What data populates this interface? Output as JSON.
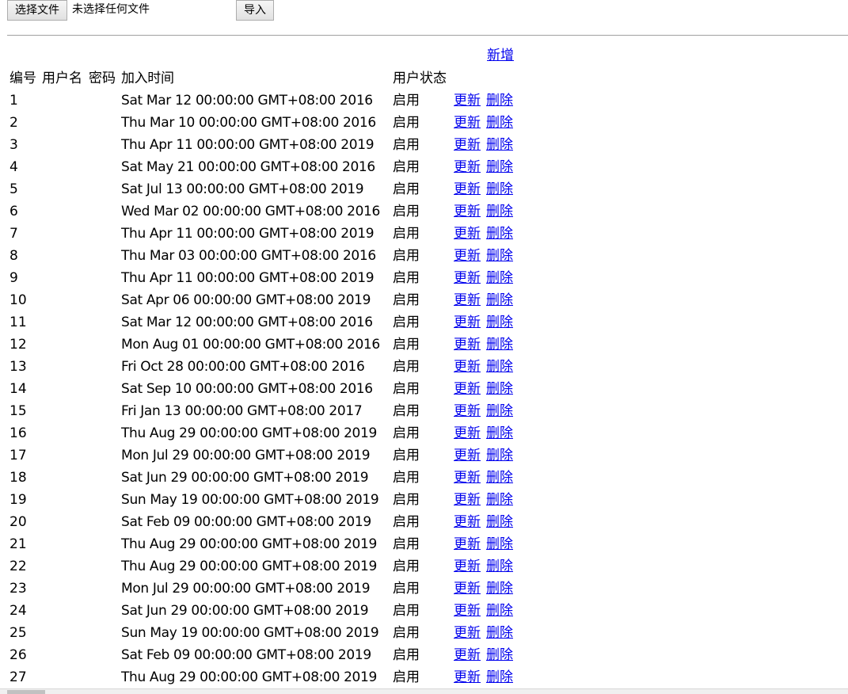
{
  "upload": {
    "choose_label": "选择文件",
    "file_status": "未选择任何文件",
    "import_label": "导入"
  },
  "add_label": "新增",
  "table": {
    "headers": {
      "id": "编号",
      "username": "用户名",
      "password": "密码",
      "join_time": "加入时间",
      "status": "用户状态"
    },
    "update_label": "更新",
    "delete_label": "删除",
    "rows": [
      {
        "id": "1",
        "username": "",
        "password": "",
        "join_time": "Sat Mar 12 00:00:00 GMT+08:00 2016",
        "status": "启用"
      },
      {
        "id": "2",
        "username": "",
        "password": "",
        "join_time": "Thu Mar 10 00:00:00 GMT+08:00 2016",
        "status": "启用"
      },
      {
        "id": "3",
        "username": "",
        "password": "",
        "join_time": "Thu Apr 11 00:00:00 GMT+08:00 2019",
        "status": "启用"
      },
      {
        "id": "4",
        "username": "",
        "password": "",
        "join_time": "Sat May 21 00:00:00 GMT+08:00 2016",
        "status": "启用"
      },
      {
        "id": "5",
        "username": "",
        "password": "",
        "join_time": "Sat Jul 13 00:00:00 GMT+08:00 2019",
        "status": "启用"
      },
      {
        "id": "6",
        "username": "",
        "password": "",
        "join_time": "Wed Mar 02 00:00:00 GMT+08:00 2016",
        "status": "启用"
      },
      {
        "id": "7",
        "username": "",
        "password": "",
        "join_time": "Thu Apr 11 00:00:00 GMT+08:00 2019",
        "status": "启用"
      },
      {
        "id": "8",
        "username": "",
        "password": "",
        "join_time": "Thu Mar 03 00:00:00 GMT+08:00 2016",
        "status": "启用"
      },
      {
        "id": "9",
        "username": "",
        "password": "",
        "join_time": "Thu Apr 11 00:00:00 GMT+08:00 2019",
        "status": "启用"
      },
      {
        "id": "10",
        "username": "",
        "password": "",
        "join_time": "Sat Apr 06 00:00:00 GMT+08:00 2019",
        "status": "启用"
      },
      {
        "id": "11",
        "username": "",
        "password": "",
        "join_time": "Sat Mar 12 00:00:00 GMT+08:00 2016",
        "status": "启用"
      },
      {
        "id": "12",
        "username": "",
        "password": "",
        "join_time": "Mon Aug 01 00:00:00 GMT+08:00 2016",
        "status": "启用"
      },
      {
        "id": "13",
        "username": "",
        "password": "",
        "join_time": "Fri Oct 28 00:00:00 GMT+08:00 2016",
        "status": "启用"
      },
      {
        "id": "14",
        "username": "",
        "password": "",
        "join_time": "Sat Sep 10 00:00:00 GMT+08:00 2016",
        "status": "启用"
      },
      {
        "id": "15",
        "username": "",
        "password": "",
        "join_time": "Fri Jan 13 00:00:00 GMT+08:00 2017",
        "status": "启用"
      },
      {
        "id": "16",
        "username": "",
        "password": "",
        "join_time": "Thu Aug 29 00:00:00 GMT+08:00 2019",
        "status": "启用"
      },
      {
        "id": "17",
        "username": "",
        "password": "",
        "join_time": "Mon Jul 29 00:00:00 GMT+08:00 2019",
        "status": "启用"
      },
      {
        "id": "18",
        "username": "",
        "password": "",
        "join_time": "Sat Jun 29 00:00:00 GMT+08:00 2019",
        "status": "启用"
      },
      {
        "id": "19",
        "username": "",
        "password": "",
        "join_time": "Sun May 19 00:00:00 GMT+08:00 2019",
        "status": "启用"
      },
      {
        "id": "20",
        "username": "",
        "password": "",
        "join_time": "Sat Feb 09 00:00:00 GMT+08:00 2019",
        "status": "启用"
      },
      {
        "id": "21",
        "username": "",
        "password": "",
        "join_time": "Thu Aug 29 00:00:00 GMT+08:00 2019",
        "status": "启用"
      },
      {
        "id": "22",
        "username": "",
        "password": "",
        "join_time": "Thu Aug 29 00:00:00 GMT+08:00 2019",
        "status": "启用"
      },
      {
        "id": "23",
        "username": "",
        "password": "",
        "join_time": "Mon Jul 29 00:00:00 GMT+08:00 2019",
        "status": "启用"
      },
      {
        "id": "24",
        "username": "",
        "password": "",
        "join_time": "Sat Jun 29 00:00:00 GMT+08:00 2019",
        "status": "启用"
      },
      {
        "id": "25",
        "username": "",
        "password": "",
        "join_time": "Sun May 19 00:00:00 GMT+08:00 2019",
        "status": "启用"
      },
      {
        "id": "26",
        "username": "",
        "password": "",
        "join_time": "Sat Feb 09 00:00:00 GMT+08:00 2019",
        "status": "启用"
      },
      {
        "id": "27",
        "username": "",
        "password": "",
        "join_time": "Thu Aug 29 00:00:00 GMT+08:00 2019",
        "status": "启用"
      }
    ]
  },
  "colors": {
    "link": "#0000ee",
    "divider": "#a0a0a0"
  }
}
